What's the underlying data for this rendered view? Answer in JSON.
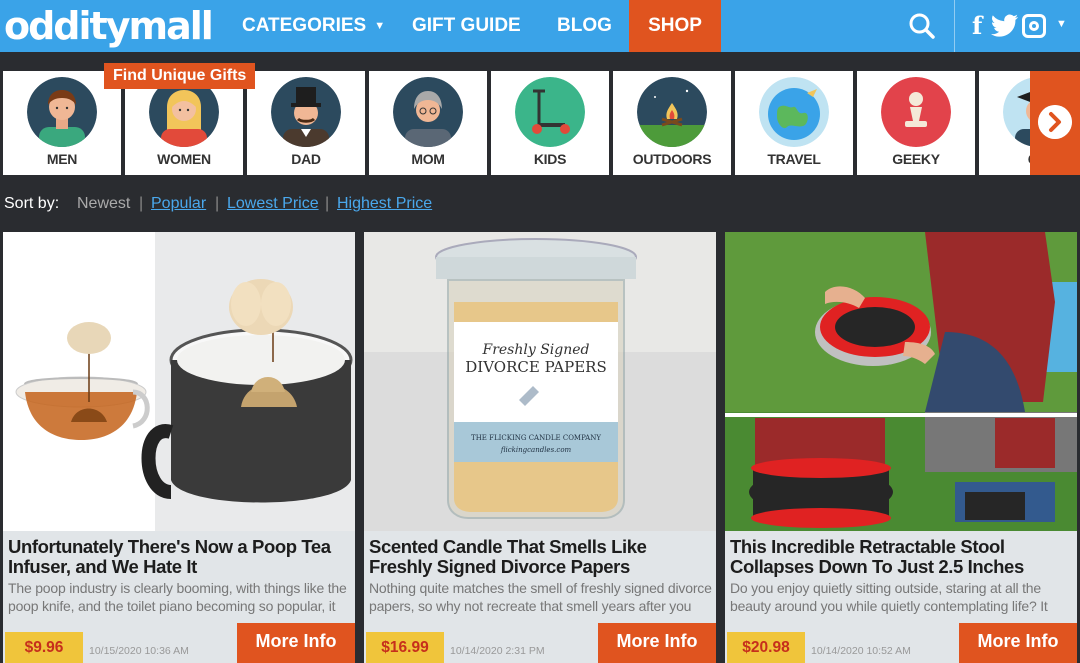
{
  "header": {
    "logo": "odditymall",
    "nav": [
      {
        "label": "CATEGORIES",
        "has_caret": true
      },
      {
        "label": "GIFT GUIDE"
      },
      {
        "label": "BLOG"
      },
      {
        "label": "SHOP",
        "active": true
      }
    ],
    "social_icons": [
      "facebook-icon",
      "twitter-icon",
      "instagram-icon"
    ],
    "facebook_glyph": "f",
    "colors": {
      "bar": "#3aa3e8",
      "accent": "#e0541f"
    }
  },
  "gift_badge": "Find Unique Gifts",
  "categories": [
    {
      "label": "MEN",
      "icon": "man-avatar-icon"
    },
    {
      "label": "WOMEN",
      "icon": "woman-avatar-icon"
    },
    {
      "label": "DAD",
      "icon": "dad-tophat-icon"
    },
    {
      "label": "MOM",
      "icon": "grandma-avatar-icon"
    },
    {
      "label": "KIDS",
      "icon": "scooter-icon"
    },
    {
      "label": "OUTDOORS",
      "icon": "campfire-icon"
    },
    {
      "label": "TRAVEL",
      "icon": "globe-plane-icon"
    },
    {
      "label": "GEEKY",
      "icon": "chess-pawn-icon"
    },
    {
      "label": "CO",
      "icon": "graduate-avatar-icon"
    }
  ],
  "sort": {
    "label": "Sort by:",
    "options": [
      "Newest",
      "Popular",
      "Lowest Price",
      "Highest Price"
    ],
    "separator": "|"
  },
  "products": [
    {
      "title": "Unfortunately There's Now a Poop Tea Infuser, and We Hate It",
      "description": "The poop industry is clearly booming, with things like the poop knife, and the toilet piano becoming so popular, it",
      "price": "$9.96",
      "date": "10/15/2020 10:36 AM",
      "button": "More Info"
    },
    {
      "title": "Scented Candle That Smells Like Freshly Signed Divorce Papers",
      "description": "Nothing quite matches the smell of freshly signed divorce papers, so why not recreate that smell years after you",
      "price": "$16.99",
      "date": "10/14/2020 2:31 PM",
      "button": "More Info",
      "label_lines": [
        "Freshly Signed",
        "DIVORCE PAPERS",
        "THE FLICKING CANDLE COMPANY",
        "flickingcandles.com"
      ]
    },
    {
      "title": "This Incredible Retractable Stool Collapses Down To Just 2.5 Inches",
      "description": "Do you enjoy quietly sitting outside, staring at all the beauty around you while quietly contemplating life? It",
      "price": "$20.98",
      "date": "10/14/2020 10:52 AM",
      "button": "More Info"
    }
  ]
}
